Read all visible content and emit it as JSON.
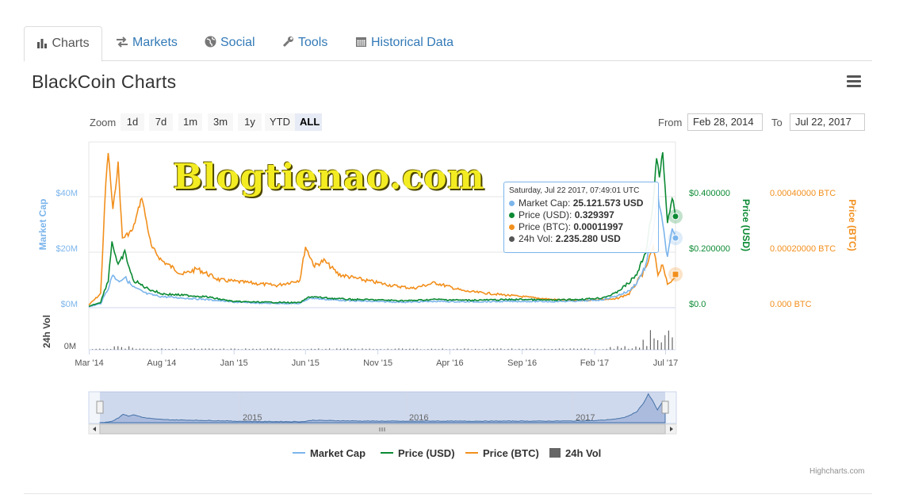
{
  "tabs": [
    {
      "label": "Charts",
      "icon": "bar-chart-icon",
      "active": true
    },
    {
      "label": "Markets",
      "icon": "exchange-arrows-icon",
      "active": false
    },
    {
      "label": "Social",
      "icon": "globe-icon",
      "active": false
    },
    {
      "label": "Tools",
      "icon": "wrench-icon",
      "active": false
    },
    {
      "label": "Historical Data",
      "icon": "calendar-icon",
      "active": false
    }
  ],
  "title": "BlackCoin Charts",
  "zoom": {
    "label": "Zoom",
    "buttons": [
      "1d",
      "7d",
      "1m",
      "3m",
      "1y",
      "YTD",
      "ALL"
    ],
    "active": "ALL"
  },
  "range": {
    "from_label": "From",
    "from": "Feb 28, 2014",
    "to_label": "To",
    "to": "Jul 22, 2017"
  },
  "watermark": "Blogtienao.com",
  "tooltip": {
    "header": "Saturday, Jul 22 2017, 07:49:01 UTC",
    "rows": [
      {
        "label": "Market Cap:",
        "value": "25.121.573 USD",
        "color": "#7cb5ec"
      },
      {
        "label": "Price (USD):",
        "value": "0.329397",
        "color": "#0b8a33"
      },
      {
        "label": "Price (BTC):",
        "value": "0.00011997",
        "color": "#f28f1c"
      },
      {
        "label": "24h Vol:",
        "value": "2.235.280 USD",
        "color": "#555555"
      }
    ]
  },
  "legend": [
    {
      "name": "Market Cap",
      "color": "#7cb5ec",
      "kind": "line"
    },
    {
      "name": "Price (USD)",
      "color": "#0b8a33",
      "kind": "line"
    },
    {
      "name": "Price (BTC)",
      "color": "#f28f1c",
      "kind": "line"
    },
    {
      "name": "24h Vol",
      "color": "#666666",
      "kind": "box"
    }
  ],
  "credits": "Highcharts.com",
  "chart_data": {
    "type": "line",
    "x_range": [
      "2014-02-28",
      "2017-07-22"
    ],
    "x_ticks": [
      "Mar '14",
      "Aug '14",
      "Jan '15",
      "Jun '15",
      "Nov '15",
      "Apr '16",
      "Sep '16",
      "Feb '17",
      "Jul '17"
    ],
    "x_tick_dates": [
      "2014-03-01",
      "2014-08-01",
      "2015-01-01",
      "2015-06-01",
      "2015-11-01",
      "2016-04-01",
      "2016-09-01",
      "2017-02-01",
      "2017-07-01"
    ],
    "axes": {
      "market_cap": {
        "label": "Market Cap",
        "ticks": [
          "$0M",
          "$20M",
          "$40M"
        ],
        "values": [
          0,
          20,
          40
        ],
        "unit": "M USD",
        "color": "#7cb5ec"
      },
      "price_usd": {
        "label": "Price (USD)",
        "ticks": [
          "$0.0",
          "$0.200000",
          "$0.400000"
        ],
        "values": [
          0,
          0.2,
          0.4
        ],
        "color": "#0b8a33"
      },
      "price_btc": {
        "label": "Price (BTC)",
        "ticks": [
          "0.000 BTC",
          "0.00020000 BTC",
          "0.00040000 BTC"
        ],
        "values": [
          0,
          0.0002,
          0.0004
        ],
        "color": "#f28f1c"
      },
      "volume": {
        "label": "24h Vol",
        "ticks": [
          "0M"
        ]
      }
    },
    "series": [
      {
        "name": "Market Cap",
        "axis": "market_cap",
        "points": [
          [
            "2014-02-28",
            0.3
          ],
          [
            "2014-03-25",
            1.5
          ],
          [
            "2014-04-10",
            7
          ],
          [
            "2014-04-20",
            12
          ],
          [
            "2014-05-01",
            9.5
          ],
          [
            "2014-05-15",
            11
          ],
          [
            "2014-06-01",
            7.5
          ],
          [
            "2014-07-01",
            5
          ],
          [
            "2014-08-01",
            4
          ],
          [
            "2014-09-15",
            3.5
          ],
          [
            "2014-11-01",
            3
          ],
          [
            "2015-01-01",
            2
          ],
          [
            "2015-03-01",
            1.6
          ],
          [
            "2015-05-20",
            1.5
          ],
          [
            "2015-06-10",
            3.5
          ],
          [
            "2015-07-15",
            3
          ],
          [
            "2015-09-01",
            2.5
          ],
          [
            "2015-11-01",
            2.2
          ],
          [
            "2016-01-01",
            2
          ],
          [
            "2016-03-01",
            2.3
          ],
          [
            "2016-05-01",
            2.1
          ],
          [
            "2016-07-01",
            2.2
          ],
          [
            "2016-09-01",
            2.3
          ],
          [
            "2016-11-01",
            2.2
          ],
          [
            "2017-01-01",
            2.4
          ],
          [
            "2017-02-15",
            2.8
          ],
          [
            "2017-03-15",
            4
          ],
          [
            "2017-04-15",
            6
          ],
          [
            "2017-05-01",
            9
          ],
          [
            "2017-05-20",
            15
          ],
          [
            "2017-06-05",
            28
          ],
          [
            "2017-06-15",
            40
          ],
          [
            "2017-06-25",
            30
          ],
          [
            "2017-07-05",
            18
          ],
          [
            "2017-07-15",
            28
          ],
          [
            "2017-07-22",
            25.1
          ]
        ]
      },
      {
        "name": "Price (USD)",
        "axis": "price_usd",
        "points": [
          [
            "2014-02-28",
            0.005
          ],
          [
            "2014-03-25",
            0.02
          ],
          [
            "2014-04-10",
            0.1
          ],
          [
            "2014-04-18",
            0.24
          ],
          [
            "2014-05-01",
            0.15
          ],
          [
            "2014-05-15",
            0.2
          ],
          [
            "2014-06-01",
            0.1
          ],
          [
            "2014-07-01",
            0.07
          ],
          [
            "2014-08-01",
            0.05
          ],
          [
            "2014-09-15",
            0.045
          ],
          [
            "2014-11-01",
            0.04
          ],
          [
            "2015-01-01",
            0.022
          ],
          [
            "2015-03-01",
            0.02
          ],
          [
            "2015-05-20",
            0.018
          ],
          [
            "2015-06-10",
            0.04
          ],
          [
            "2015-07-15",
            0.035
          ],
          [
            "2015-09-01",
            0.03
          ],
          [
            "2015-11-01",
            0.028
          ],
          [
            "2016-01-01",
            0.025
          ],
          [
            "2016-03-01",
            0.03
          ],
          [
            "2016-05-01",
            0.027
          ],
          [
            "2016-07-01",
            0.028
          ],
          [
            "2016-09-01",
            0.03
          ],
          [
            "2016-11-01",
            0.027
          ],
          [
            "2017-01-01",
            0.03
          ],
          [
            "2017-02-15",
            0.035
          ],
          [
            "2017-03-15",
            0.05
          ],
          [
            "2017-04-15",
            0.09
          ],
          [
            "2017-05-01",
            0.12
          ],
          [
            "2017-05-20",
            0.2
          ],
          [
            "2017-06-05",
            0.38
          ],
          [
            "2017-06-12",
            0.54
          ],
          [
            "2017-06-18",
            0.47
          ],
          [
            "2017-06-25",
            0.56
          ],
          [
            "2017-07-05",
            0.3
          ],
          [
            "2017-07-15",
            0.4
          ],
          [
            "2017-07-22",
            0.329
          ]
        ]
      },
      {
        "name": "Price (BTC)",
        "axis": "price_btc",
        "points": [
          [
            "2014-02-28",
            1e-05
          ],
          [
            "2014-03-25",
            5e-05
          ],
          [
            "2014-04-05",
            0.00045
          ],
          [
            "2014-04-10",
            0.00056
          ],
          [
            "2014-04-20",
            0.00035
          ],
          [
            "2014-05-01",
            0.00052
          ],
          [
            "2014-05-10",
            0.00025
          ],
          [
            "2014-06-01",
            0.00028
          ],
          [
            "2014-06-20",
            0.0004
          ],
          [
            "2014-07-10",
            0.00022
          ],
          [
            "2014-08-01",
            0.00017
          ],
          [
            "2014-09-15",
            0.00012
          ],
          [
            "2014-10-15",
            0.00014
          ],
          [
            "2014-12-01",
            0.0001
          ],
          [
            "2015-02-01",
            9e-05
          ],
          [
            "2015-04-01",
            8e-05
          ],
          [
            "2015-05-20",
            0.0001
          ],
          [
            "2015-06-01",
            0.00022
          ],
          [
            "2015-06-20",
            0.00015
          ],
          [
            "2015-07-10",
            0.00017
          ],
          [
            "2015-08-10",
            0.00012
          ],
          [
            "2015-10-01",
            0.0001
          ],
          [
            "2015-12-01",
            8e-05
          ],
          [
            "2016-01-15",
            7e-05
          ],
          [
            "2016-03-01",
            9e-05
          ],
          [
            "2016-05-01",
            6e-05
          ],
          [
            "2016-07-01",
            5e-05
          ],
          [
            "2016-09-01",
            4e-05
          ],
          [
            "2016-11-01",
            3e-05
          ],
          [
            "2017-01-01",
            2.5e-05
          ],
          [
            "2017-02-15",
            3e-05
          ],
          [
            "2017-03-15",
            3e-05
          ],
          [
            "2017-04-15",
            5e-05
          ],
          [
            "2017-05-01",
            9e-05
          ],
          [
            "2017-05-20",
            0.00014
          ],
          [
            "2017-06-05",
            0.00022
          ],
          [
            "2017-06-15",
            0.00012
          ],
          [
            "2017-06-25",
            0.00016
          ],
          [
            "2017-07-05",
            8e-05
          ],
          [
            "2017-07-15",
            0.0001
          ],
          [
            "2017-07-22",
            0.00012
          ]
        ]
      }
    ],
    "navigator": {
      "year_labels": [
        "2015",
        "2016",
        "2017"
      ]
    },
    "legend_position": "bottom-center",
    "grid": true
  }
}
